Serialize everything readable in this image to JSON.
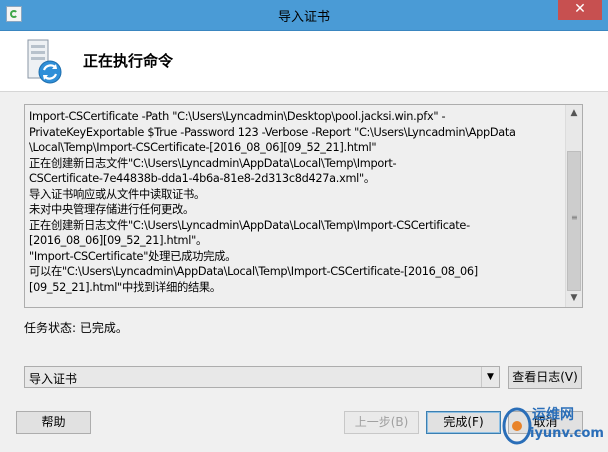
{
  "window": {
    "title": "导入证书",
    "close_glyph": "✕"
  },
  "header": {
    "title": "正在执行命令",
    "icon": "server-sync-icon"
  },
  "log": {
    "lines": [
      "Import-CSCertificate -Path \"C:\\Users\\Lyncadmin\\Desktop\\pool.jacksi.win.pfx\" -",
      "PrivateKeyExportable $True -Password 123 -Verbose -Report \"C:\\Users\\Lyncadmin\\AppData",
      "\\Local\\Temp\\Import-CSCertificate-[2016_08_06][09_52_21].html\"",
      "正在创建新日志文件\"C:\\Users\\Lyncadmin\\AppData\\Local\\Temp\\Import-",
      "CSCertificate-7e44838b-dda1-4b6a-81e8-2d313c8d427a.xml\"。",
      "导入证书响应或从文件中读取证书。",
      "未对中央管理存储进行任何更改。",
      "正在创建新日志文件\"C:\\Users\\Lyncadmin\\AppData\\Local\\Temp\\Import-CSCertificate-",
      "[2016_08_06][09_52_21].html\"。",
      "\"Import-CSCertificate\"处理已成功完成。",
      "可以在\"C:\\Users\\Lyncadmin\\AppData\\Local\\Temp\\Import-CSCertificate-[2016_08_06]",
      "[09_52_21].html\"中找到详细的结果。"
    ]
  },
  "status": {
    "text": "任务状态: 已完成。"
  },
  "dropdown": {
    "selected": "导入证书"
  },
  "buttons": {
    "view_log": "查看日志(V)",
    "help": "帮助",
    "back": "上一步(B)",
    "finish": "完成(F)",
    "cancel": "取消"
  },
  "watermark": {
    "line1": "运维网",
    "line2": "iyunv.com"
  },
  "colors": {
    "titlebar": "#4a9bd6",
    "close": "#c75050",
    "accent": "#2a6eb8"
  }
}
